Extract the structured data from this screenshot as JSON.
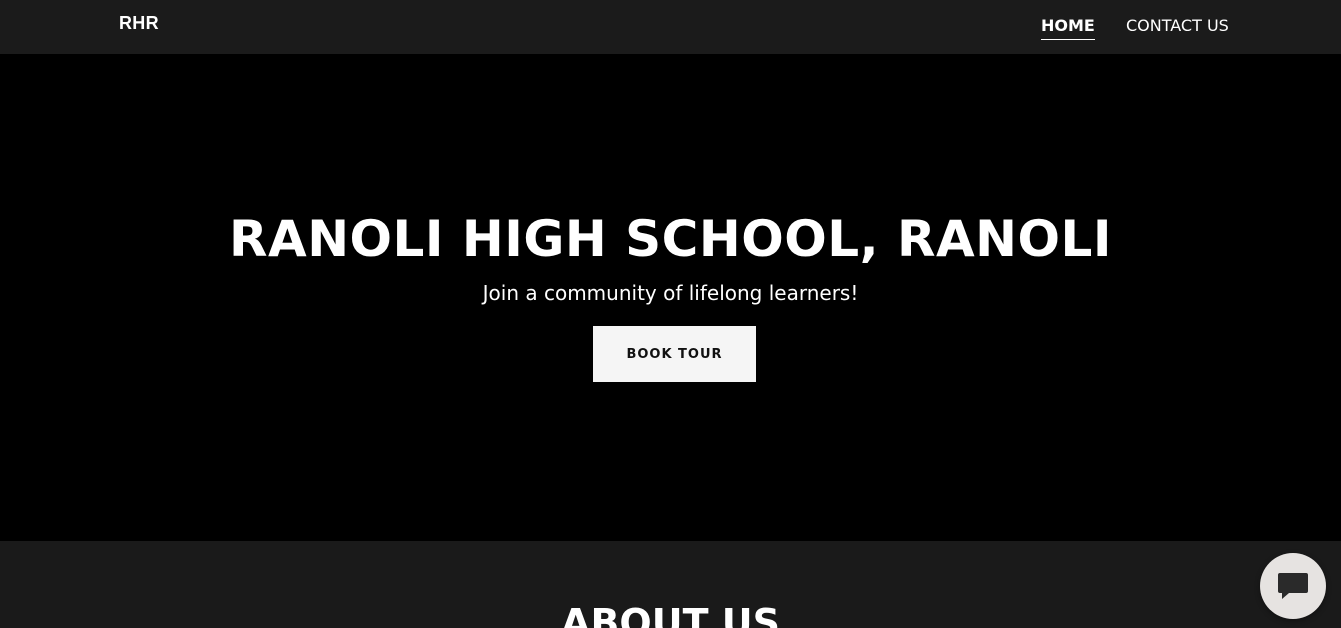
{
  "header": {
    "logo": "RHR",
    "nav": [
      {
        "label": "HOME",
        "active": true
      },
      {
        "label": "CONTACT US",
        "active": false
      }
    ]
  },
  "hero": {
    "title": "RANOLI HIGH SCHOOL, RANOLI",
    "subtitle": "Join a community of lifelong learners!",
    "cta_label": "BOOK TOUR"
  },
  "about": {
    "title": "ABOUT US"
  },
  "chat": {
    "icon": "chat-bubble-icon"
  },
  "colors": {
    "nav_bg": "#1b1b1b",
    "hero_bg": "#000000",
    "section_bg": "#1a1a1a",
    "text": "#ffffff",
    "button_bg": "#f5f5f5",
    "chat_bg": "#e6e3e1"
  }
}
